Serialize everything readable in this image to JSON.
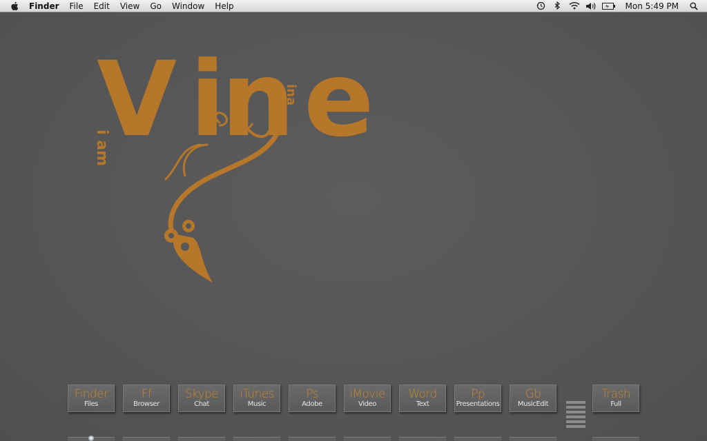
{
  "menubar": {
    "app_name": "Finder",
    "menus": [
      "File",
      "Edit",
      "View",
      "Go",
      "Window",
      "Help"
    ],
    "status_icons": [
      "time-machine-icon",
      "bluetooth-icon",
      "wifi-icon",
      "volume-icon",
      "battery-icon"
    ],
    "clock": "Mon 5:49 PM"
  },
  "wallpaper": {
    "logo_word_1": "V",
    "logo_word_2": "in",
    "logo_word_3": "e",
    "logo_small_1": "i am",
    "logo_small_2": "ina",
    "accent_color": "#b7772a"
  },
  "dock": {
    "tiles": [
      {
        "title": "Finder",
        "sub": "Files"
      },
      {
        "title": "Ff",
        "sub": "Browser"
      },
      {
        "title": "Skype",
        "sub": "Chat"
      },
      {
        "title": "iTunes",
        "sub": "Music"
      },
      {
        "title": "Ps",
        "sub": "Adobe"
      },
      {
        "title": "iMovie",
        "sub": "Video"
      },
      {
        "title": "Word",
        "sub": "Text"
      },
      {
        "title": "Pp",
        "sub": "Presentations"
      },
      {
        "title": "Gb",
        "sub": "MusicEdit"
      },
      {
        "title": "Trash",
        "sub": "Full"
      }
    ]
  }
}
